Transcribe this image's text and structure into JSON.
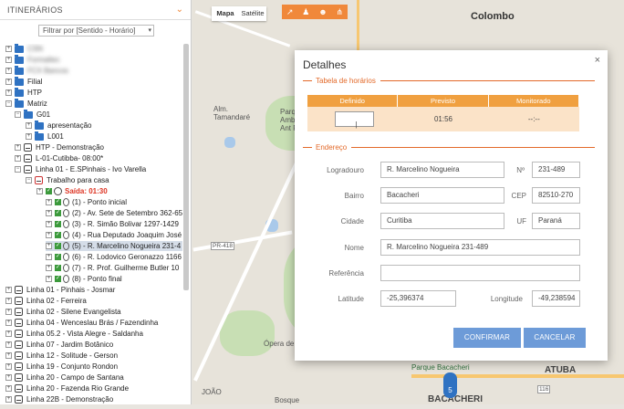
{
  "sidebar": {
    "title": "ITINERÁRIOS",
    "filter_placeholder": "Filtrar por [Sentido - Horário]",
    "items": [
      {
        "label": "CSN",
        "level": 0,
        "kind": "folder",
        "blurred": true
      },
      {
        "label": "Formaltec",
        "level": 0,
        "kind": "folder",
        "blurred": true
      },
      {
        "label": "FCX Bancos",
        "level": 0,
        "kind": "folder",
        "blurred": true
      },
      {
        "label": "Filial",
        "level": 0,
        "kind": "folder"
      },
      {
        "label": "HTP",
        "level": 0,
        "kind": "folder"
      },
      {
        "label": "Matriz",
        "level": 0,
        "kind": "folder",
        "open": true
      },
      {
        "label": "G01",
        "level": 1,
        "kind": "folder",
        "open": true
      },
      {
        "label": "apresentação",
        "level": 2,
        "kind": "folder"
      },
      {
        "label": "L001",
        "level": 2,
        "kind": "folder"
      },
      {
        "label": "HTP - Demonstração",
        "level": 1,
        "kind": "bus"
      },
      {
        "label": "L-01-Cutibba- 08:00*",
        "level": 1,
        "kind": "bus"
      },
      {
        "label": "Linha 01 - E.SPinhais - Ivo Varella",
        "level": 1,
        "kind": "bus",
        "open": true
      },
      {
        "label": "Trabalho para casa",
        "level": 2,
        "kind": "bus-red",
        "open": true
      },
      {
        "label": "Saída: 01:30",
        "level": 3,
        "kind": "clock",
        "highlight": true
      },
      {
        "label": "(1) - Ponto inicial",
        "level": 4,
        "kind": "stop"
      },
      {
        "label": "(2) - Av. Sete de Setembro 362-65",
        "level": 4,
        "kind": "stop"
      },
      {
        "label": "(3) - R. Simão Bolivar 1297-1429",
        "level": 4,
        "kind": "stop"
      },
      {
        "label": "(4) - Rua Deputado Joaquim José",
        "level": 4,
        "kind": "stop"
      },
      {
        "label": "(5) - R. Marcelino Nogueira 231-4",
        "level": 4,
        "kind": "stop",
        "selected": true
      },
      {
        "label": "(6) - R. Lodovico Geronazzo 1166",
        "level": 4,
        "kind": "stop"
      },
      {
        "label": "(7) - R. Prof. Guilherme Butler 10",
        "level": 4,
        "kind": "stop"
      },
      {
        "label": "(8) - Ponto final",
        "level": 4,
        "kind": "stop"
      },
      {
        "label": "Linha 01 - Pinhais - Josmar",
        "level": 0,
        "kind": "bus"
      },
      {
        "label": "Linha 02 - Ferreira",
        "level": 0,
        "kind": "bus"
      },
      {
        "label": "Linha 02 - Silene Evangelista",
        "level": 0,
        "kind": "bus"
      },
      {
        "label": "Linha 04 - Wenceslau Brás / Fazendinha",
        "level": 0,
        "kind": "bus"
      },
      {
        "label": "Linha 05.2 - Vista Alegre - Saldanha",
        "level": 0,
        "kind": "bus"
      },
      {
        "label": "Linha 07 - Jardim Botânico",
        "level": 0,
        "kind": "bus"
      },
      {
        "label": "Linha 12 - Solitude - Gerson",
        "level": 0,
        "kind": "bus"
      },
      {
        "label": "Linha 19 - Conjunto Rondon",
        "level": 0,
        "kind": "bus"
      },
      {
        "label": "Linha 20 - Campo de Santana",
        "level": 0,
        "kind": "bus"
      },
      {
        "label": "Linha 20 - Fazenda Rio Grande",
        "level": 0,
        "kind": "bus"
      },
      {
        "label": "Linha 22B - Demonstração",
        "level": 0,
        "kind": "bus"
      },
      {
        "label": "Linha 22B - Demonstração",
        "level": 0,
        "kind": "bus"
      }
    ]
  },
  "map": {
    "tab_map": "Mapa",
    "tab_satellite": "Satélite",
    "labels": {
      "colombo": "Colombo",
      "atuba": "ATUBA",
      "bacacheri": "BACACHERI",
      "alm": "Alm.\nTamandaré",
      "parque": "Parque\nAmbie\nAnt P",
      "opera": "Ópera de",
      "parque_bac": "Parque Bacacheri",
      "joao": "JOÃO",
      "bosque": "Bosque",
      "pr418": "PR-418",
      "br116": "116",
      "marker": "5"
    }
  },
  "modal": {
    "title": "Detalhes",
    "close": "×",
    "section_schedule": "Tabela de horários",
    "section_address": "Endereço",
    "table": {
      "headers": [
        "Definido",
        "Previsto",
        "Monitorado"
      ],
      "defined_value": "",
      "predicted": "01:56",
      "monitored": "--:--"
    },
    "fields": {
      "logradouro_label": "Logradouro",
      "logradouro": "R. Marcelino Nogueira",
      "numero_label": "Nº",
      "numero": "231-489",
      "bairro_label": "Bairro",
      "bairro": "Bacacheri",
      "cep_label": "CEP",
      "cep": "82510-270",
      "cidade_label": "Cidade",
      "cidade": "Curitiba",
      "uf_label": "UF",
      "uf": "Paraná",
      "nome_label": "Nome",
      "nome": "R. Marcelino Nogueira 231-489",
      "referencia_label": "Referência",
      "referencia": "",
      "latitude_label": "Latitude",
      "latitude": "-25,396374",
      "longitude_label": "Longitude",
      "longitude": "-49,238594"
    },
    "confirm": "CONFIRMAR",
    "cancel": "CANCELAR"
  },
  "colors": {
    "accent": "#f0883a",
    "primary_button": "#6d9bd8",
    "folder": "#2f72c2"
  }
}
